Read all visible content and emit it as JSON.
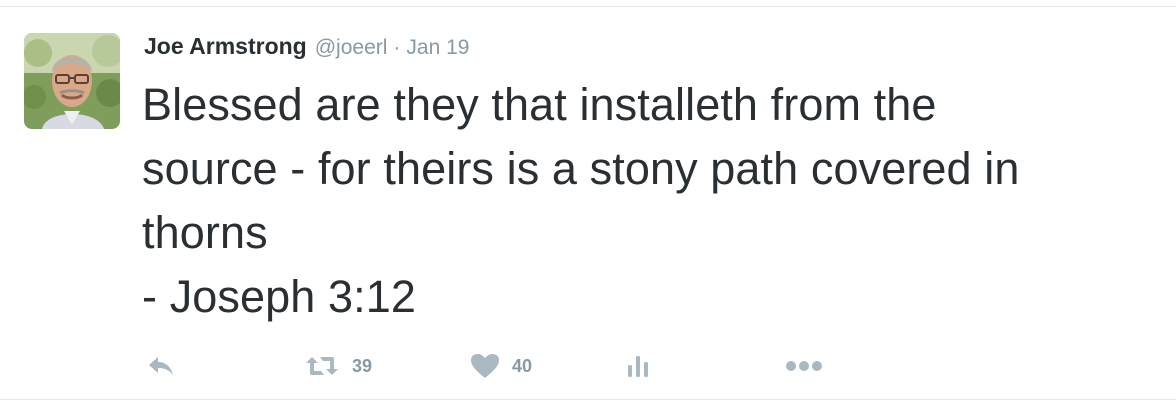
{
  "tweet": {
    "author_name": "Joe Armstrong",
    "handle": "@joeerl",
    "separator": "·",
    "date": "Jan 19",
    "text_lines": [
      "Blessed are they that installeth from the",
      "source - for theirs is a stony path covered in",
      "thorns",
      "- Joseph 3:12"
    ]
  },
  "actions": {
    "reply": {
      "icon": "reply-icon"
    },
    "retweet": {
      "icon": "retweet-icon",
      "count": "39"
    },
    "like": {
      "icon": "heart-icon",
      "count": "40"
    },
    "analytics": {
      "icon": "analytics-icon"
    },
    "more": {
      "icon": "more-icon"
    }
  },
  "colors": {
    "text": "#292f33",
    "muted": "#8899a6",
    "icon": "#aab8c2",
    "border": "#e1e8ed"
  }
}
